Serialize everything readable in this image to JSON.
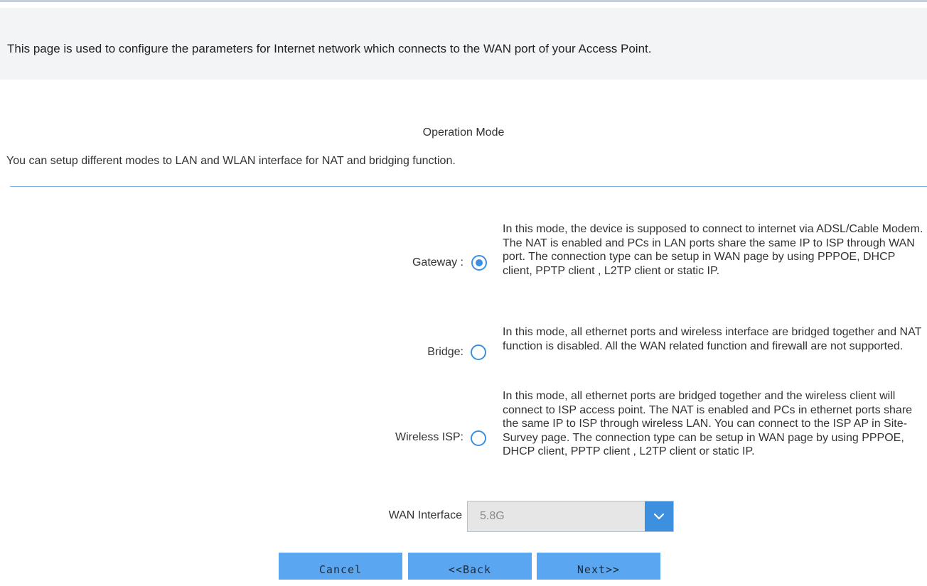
{
  "header": {
    "info_text": "This page is used to configure the parameters for Internet network which connects to the WAN port of your Access Point."
  },
  "section": {
    "title": "Operation Mode",
    "description": "You can setup different modes to LAN and WLAN interface for NAT and bridging function."
  },
  "modes": [
    {
      "label": "Gateway :",
      "selected": true,
      "description": "In this mode, the device is supposed to connect to internet via ADSL/Cable Modem. The NAT is enabled and PCs in LAN ports share the same IP to ISP through WAN port. The connection type can be setup in WAN page by using PPPOE, DHCP client, PPTP client , L2TP client or static IP."
    },
    {
      "label": "Bridge:",
      "selected": false,
      "description": "In this mode, all ethernet ports and wireless interface are bridged together and NAT function is disabled. All the WAN related function and firewall are not supported."
    },
    {
      "label": "Wireless ISP:",
      "selected": false,
      "description": "In this mode, all ethernet ports are bridged together and the wireless client will connect to ISP access point. The NAT is enabled and PCs in ethernet ports share the same IP to ISP through wireless LAN. You can connect to the ISP AP in Site-Survey page. The connection type can be setup in WAN page by using PPPOE, DHCP client, PPTP client , L2TP client or static IP."
    }
  ],
  "wan_interface": {
    "label": "WAN Interface",
    "value": "5.8G",
    "arrow_icon": "chevron-down-icon"
  },
  "buttons": {
    "cancel": "Cancel",
    "back": "<<Back",
    "next": "Next>>"
  },
  "colors": {
    "accent": "#3d8fe0",
    "button_bg": "#5ba6f0",
    "banner_bg": "#f2f4f6",
    "divider": "#7eb3e3"
  }
}
